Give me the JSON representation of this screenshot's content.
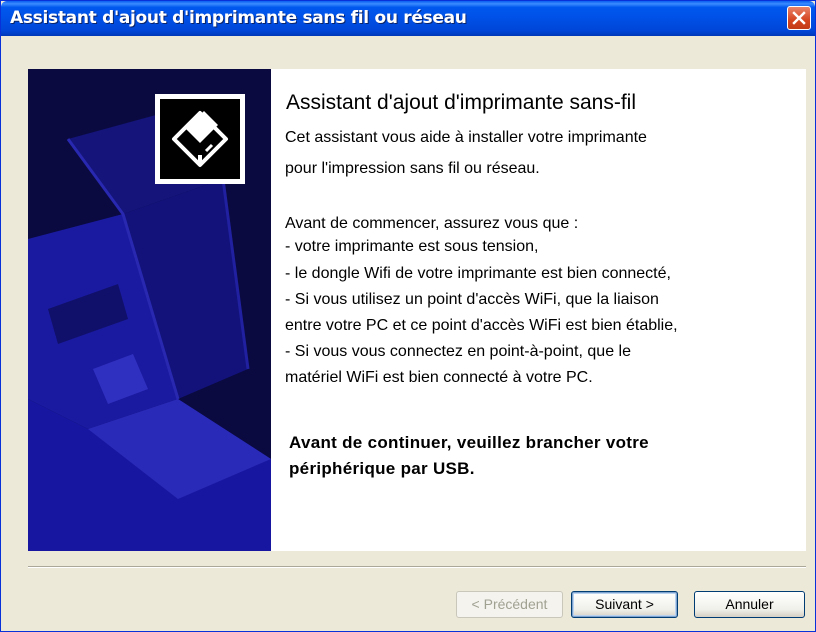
{
  "window": {
    "title": "Assistant d'ajout d'imprimante sans fil ou réseau",
    "close_icon": "close-icon"
  },
  "banner": {
    "icon": "printer-icon",
    "colors": {
      "background": "#0a0a40",
      "artwork": "#1a1aa0"
    }
  },
  "main": {
    "heading": "Assistant d'ajout d'imprimante sans-fil",
    "intro_lines": [
      "Cet assistant vous aide à installer votre imprimante",
      "pour l'impression sans fil ou réseau."
    ],
    "checklist_lines": [
      "Avant de commencer, assurez vous que :",
      "- votre imprimante est sous tension,",
      "- le dongle Wifi de votre imprimante est bien connecté,",
      "- Si vous utilisez un point d'accès WiFi, que la liaison",
      "entre votre PC et ce point d'accès WiFi est bien établie,",
      "- Si vous vous connectez en point-à-point, que le",
      "matériel WiFi est bien connecté à votre PC."
    ],
    "warning_lines": [
      "Avant de continuer, veuillez brancher votre",
      "périphérique par USB."
    ]
  },
  "buttons": {
    "previous": "< Précédent",
    "next": "Suivant >",
    "cancel": "Annuler"
  }
}
